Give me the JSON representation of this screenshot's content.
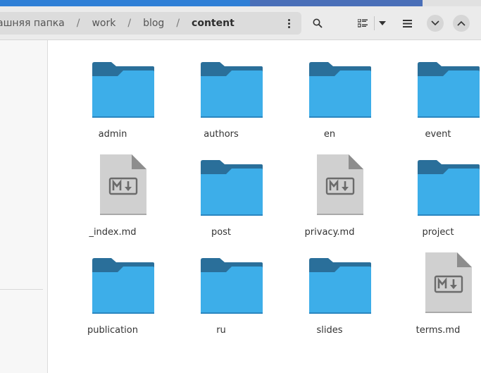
{
  "pathbar": {
    "crumbs": [
      "ашняя папка",
      "work",
      "blog",
      "content"
    ],
    "separator": "/"
  },
  "toolbar": {
    "search_icon": "search-icon",
    "view_icon": "list-view-icon",
    "view_dropdown_icon": "chevron-down-icon",
    "menu_icon": "hamburger-menu-icon",
    "down_icon": "chevron-down-icon",
    "up_icon": "chevron-up-icon"
  },
  "colors": {
    "folder_front": "#3daee9",
    "folder_back": "#2a6f9a",
    "doc_bg": "#d0d0d0"
  },
  "files": [
    {
      "name": "admin",
      "type": "folder"
    },
    {
      "name": "authors",
      "type": "folder"
    },
    {
      "name": "en",
      "type": "folder"
    },
    {
      "name": "event",
      "type": "folder"
    },
    {
      "name": "_index.md",
      "type": "markdown"
    },
    {
      "name": "post",
      "type": "folder"
    },
    {
      "name": "privacy.md",
      "type": "markdown"
    },
    {
      "name": "project",
      "type": "folder"
    },
    {
      "name": "publication",
      "type": "folder"
    },
    {
      "name": "ru",
      "type": "folder"
    },
    {
      "name": "slides",
      "type": "folder"
    },
    {
      "name": "terms.md",
      "type": "markdown"
    }
  ]
}
